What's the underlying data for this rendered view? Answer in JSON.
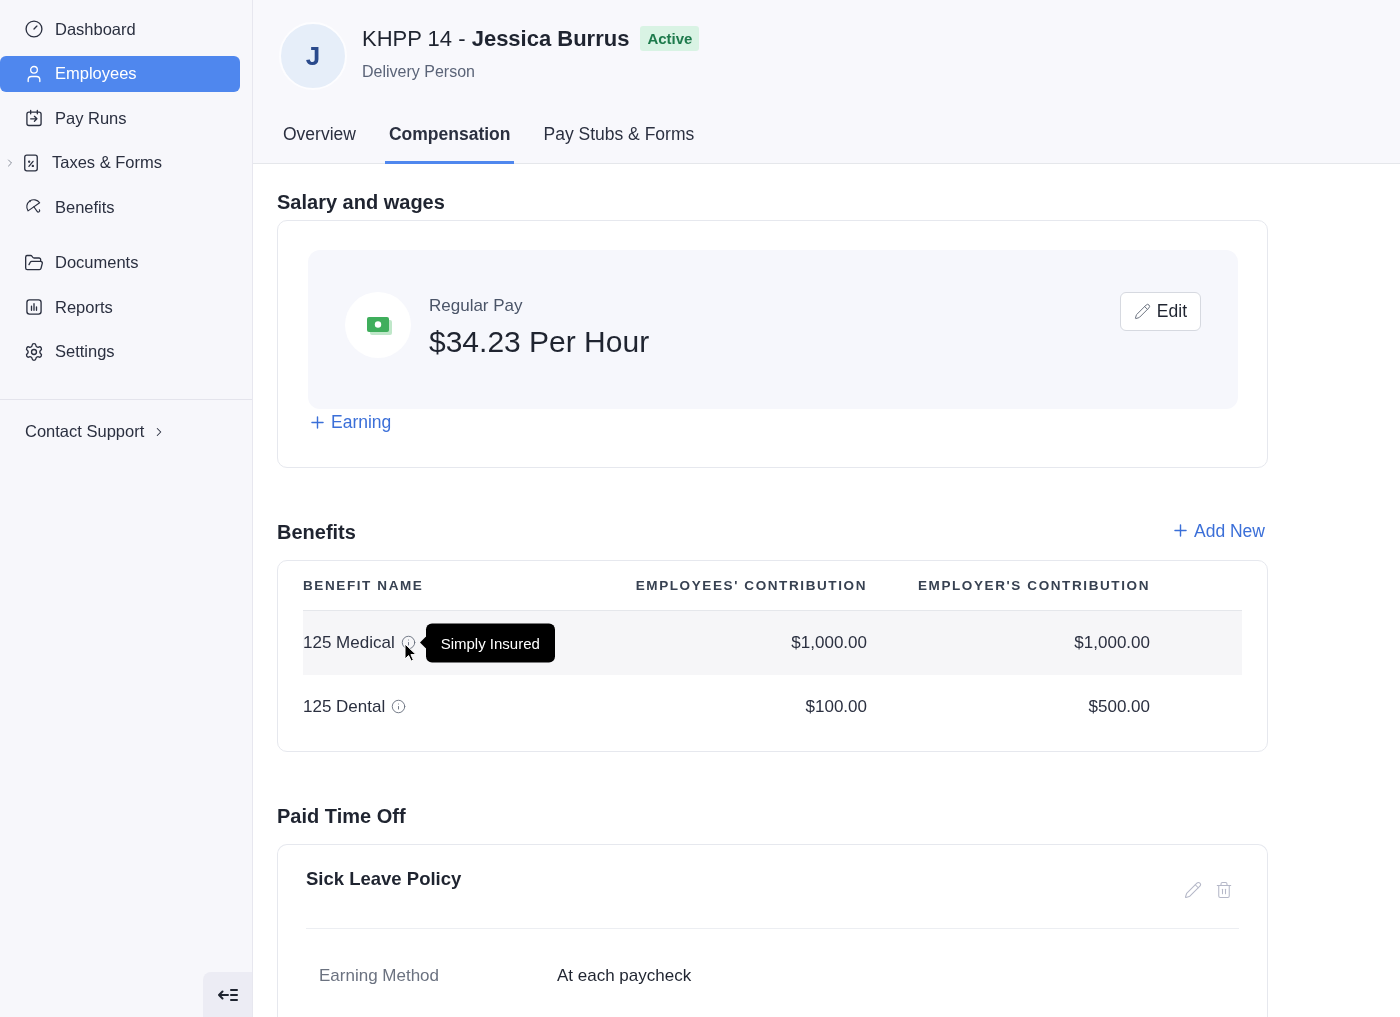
{
  "sidebar": {
    "sections": [
      {
        "items": [
          {
            "label": "Dashboard",
            "kind": "link",
            "selected": false
          },
          {
            "label": "Employees",
            "kind": "link",
            "selected": true
          },
          {
            "label": "Pay Runs",
            "kind": "link",
            "selected": false
          },
          {
            "label": "Taxes & Forms",
            "kind": "group",
            "selected": false
          },
          {
            "label": "Benefits",
            "kind": "link",
            "selected": false
          }
        ]
      },
      {
        "items": [
          {
            "label": "Documents",
            "kind": "link",
            "selected": false
          },
          {
            "label": "Reports",
            "kind": "link",
            "selected": false
          },
          {
            "label": "Settings",
            "kind": "link",
            "selected": false
          }
        ]
      }
    ],
    "contact_support": "Contact Support"
  },
  "profile": {
    "initial": "J",
    "title": "KHPP 14 - **Jessica Burrus**",
    "status": "Active",
    "role": "Delivery Person"
  },
  "tabs": [
    {
      "label": "Overview",
      "selected": false
    },
    {
      "label": "Compensation",
      "selected": true
    },
    {
      "label": "Pay Stubs & Forms",
      "selected": false
    }
  ],
  "salary": {
    "title": "Salary and wages",
    "pay_label": "Regular Pay",
    "pay_amount": "$34.23 Per Hour",
    "edit_button": "Edit",
    "add_earning": "Earning"
  },
  "benefits": {
    "title": "Benefits",
    "add_new": "Add New",
    "table": {
      "columns": [
        "BENEFIT NAME",
        "EMPLOYEES' CONTRIBUTION",
        "EMPLOYER'S CONTRIBUTION"
      ],
      "rows": [
        {
          "name": "125 Medical",
          "employees_contribution": "$1,000.00",
          "employers_contribution": "$1,000.00",
          "hovered": true,
          "tooltip": "Simply Insured"
        },
        {
          "name": "125 Dental",
          "employees_contribution": "$100.00",
          "employers_contribution": "$500.00",
          "hovered": false
        }
      ]
    }
  },
  "paid_time_off": {
    "title": "Paid Time Off",
    "policies": [
      {
        "name": "Sick Leave Policy",
        "fields": [
          {
            "label": "Earning Method",
            "value": "At each paycheck"
          }
        ]
      }
    ]
  }
}
